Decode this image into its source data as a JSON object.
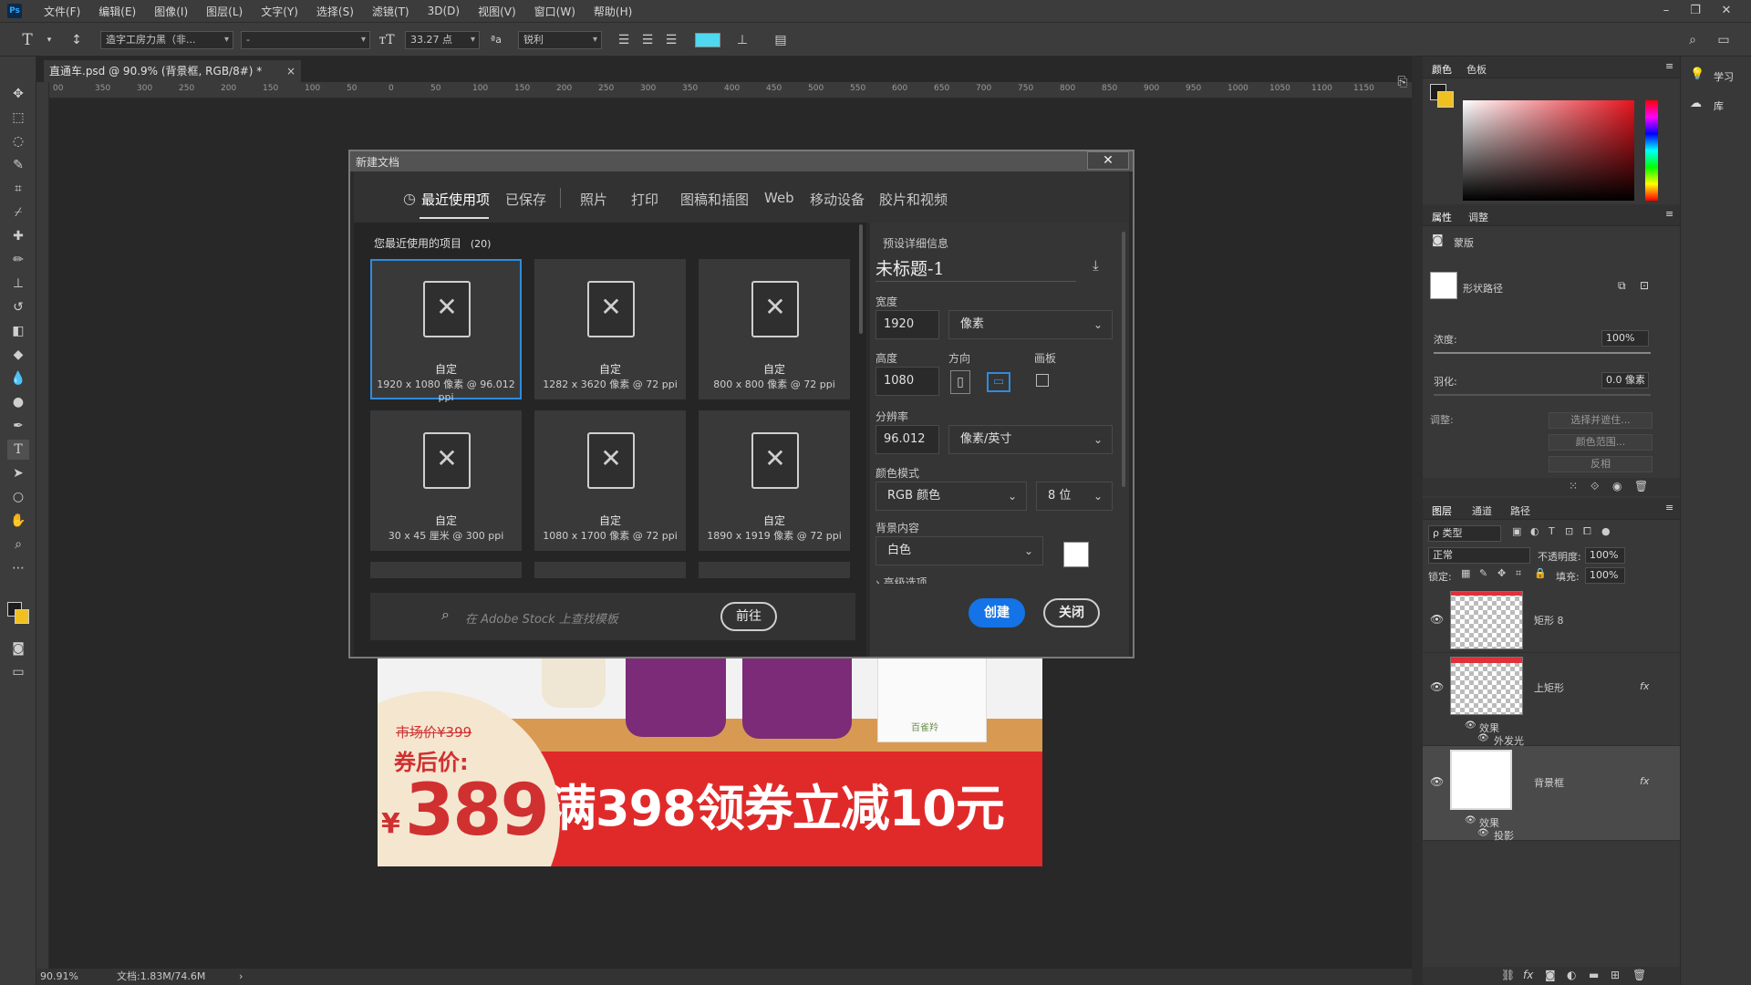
{
  "menubar": {
    "logo": "Ps",
    "items": [
      "文件(F)",
      "编辑(E)",
      "图像(I)",
      "图层(L)",
      "文字(Y)",
      "选择(S)",
      "滤镜(T)",
      "3D(D)",
      "视图(V)",
      "窗口(W)",
      "帮助(H)"
    ]
  },
  "options": {
    "tool_icon": "T",
    "font_family": "造字工房力黑（非...",
    "font_style": "-",
    "font_size": "33.27 点",
    "aa_label": "ªa",
    "antialias": "锐利",
    "text_color": "#4fd8f0"
  },
  "document": {
    "tab_title": "直通车.psd @ 90.9% (背景框, RGB/8#) *",
    "ruler_labels": [
      "00",
      "350",
      "300",
      "250",
      "200",
      "150",
      "100",
      "50",
      "0",
      "50",
      "100",
      "150",
      "200",
      "250",
      "300",
      "350",
      "400",
      "450",
      "500",
      "550",
      "600",
      "650",
      "700",
      "750",
      "800",
      "850",
      "900",
      "950",
      "1000",
      "1050",
      "1100",
      "1150"
    ],
    "zoom": "90.91%",
    "doc_info": "文档:1.83M/74.6M"
  },
  "artwork": {
    "market_price": "市场价¥399",
    "coupon_label": "券后价:",
    "price": "389",
    "currency": "¥",
    "banner": "满398领券立减10元",
    "bottle_label": "百雀羚"
  },
  "dialog": {
    "title": "新建文档",
    "tabs": [
      "最近使用项",
      "已保存",
      "照片",
      "打印",
      "图稿和插图",
      "Web",
      "移动设备",
      "胶片和视频"
    ],
    "recent_heading": "您最近使用的项目",
    "recent_count": "(20)",
    "presets": [
      {
        "name": "自定",
        "size": "1920 x 1080 像素 @ 96.012 ppi"
      },
      {
        "name": "自定",
        "size": "1282 x 3620 像素 @ 72 ppi"
      },
      {
        "name": "自定",
        "size": "800 x 800 像素 @ 72 ppi"
      },
      {
        "name": "自定",
        "size": "30 x 45 厘米 @ 300 ppi"
      },
      {
        "name": "自定",
        "size": "1080 x 1700 像素 @ 72 ppi"
      },
      {
        "name": "自定",
        "size": "1890 x 1919 像素 @ 72 ppi"
      }
    ],
    "stock_placeholder": "在 Adobe Stock 上查找模板",
    "go_button": "前往",
    "details_heading": "预设详细信息",
    "doc_name": "未标题-1",
    "width_label": "宽度",
    "width_value": "1920",
    "width_unit": "像素",
    "height_label": "高度",
    "height_value": "1080",
    "orientation_label": "方向",
    "artboard_label": "画板",
    "resolution_label": "分辨率",
    "resolution_value": "96.012",
    "resolution_unit": "像素/英寸",
    "color_mode_label": "颜色模式",
    "color_mode": "RGB 颜色",
    "bit_depth": "8 位",
    "bg_label": "背景内容",
    "bg_value": "白色",
    "advanced": "高级选项",
    "create_button": "创建",
    "close_button": "关闭"
  },
  "panels": {
    "color_tabs": [
      "颜色",
      "色板"
    ],
    "learn": "学习",
    "library": "库",
    "props_tabs": [
      "属性",
      "调整"
    ],
    "mask_label": "蒙版",
    "shape_path": "形状路径",
    "density_label": "浓度:",
    "density_value": "100%",
    "feather_label": "羽化:",
    "feather_value": "0.0 像素",
    "refine_label": "调整:",
    "select_mask": "选择并遮住...",
    "color_range": "颜色范围...",
    "invert": "反相",
    "layers_tabs": [
      "图层",
      "通道",
      "路径"
    ],
    "filter_kind": "ρ 类型",
    "blend_mode": "正常",
    "opacity_label": "不透明度:",
    "opacity_value": "100%",
    "lock_label": "锁定:",
    "fill_label": "填充:",
    "fill_value": "100%",
    "layers": [
      {
        "name": "矩形 8"
      },
      {
        "name": "上矩形",
        "effects": "效果",
        "effect1": "外发光"
      },
      {
        "name": "背景框",
        "effects": "效果",
        "effect1": "投影"
      }
    ],
    "fx": "fx"
  }
}
